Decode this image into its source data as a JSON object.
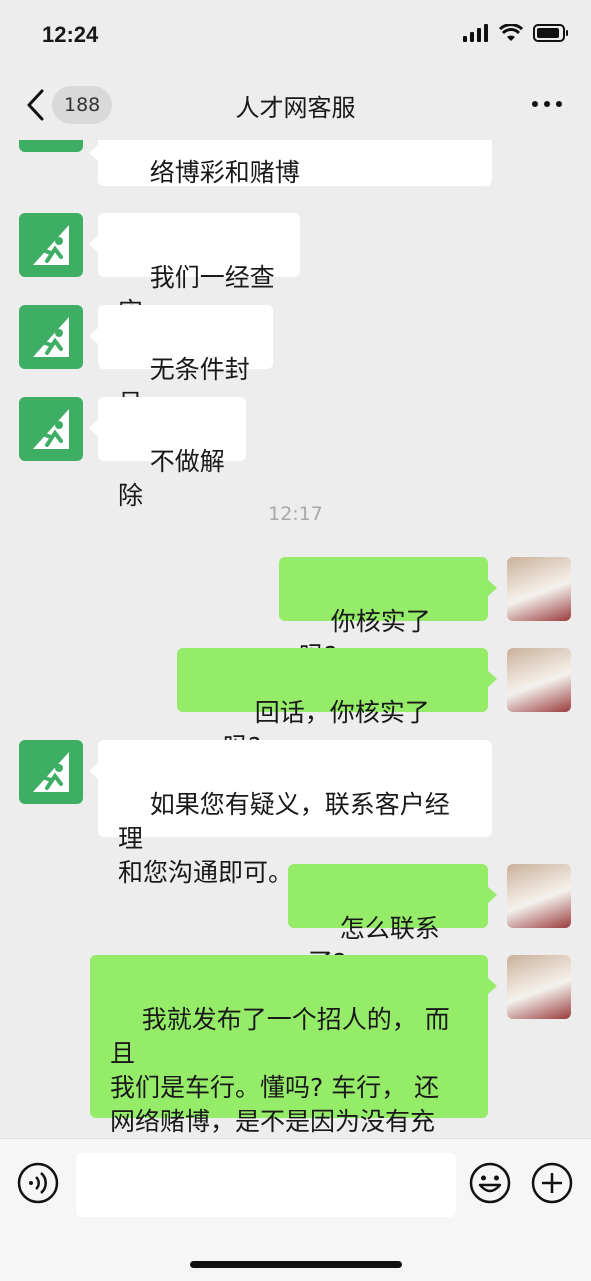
{
  "status_bar": {
    "time": "12:24"
  },
  "header": {
    "badge_count": "188",
    "title": "人才网客服"
  },
  "colors": {
    "outgoing_bubble": "#95ec69",
    "incoming_bubble": "#ffffff",
    "cs_avatar": "#3fae65",
    "background": "#ededed"
  },
  "messages": [
    {
      "side": "in",
      "text": "络博彩和赌博"
    },
    {
      "side": "in",
      "text": "我们一经查实"
    },
    {
      "side": "in",
      "text": "无条件封号"
    },
    {
      "side": "in",
      "text": "不做解除"
    },
    {
      "side": "out",
      "text": "你核实了吗?"
    },
    {
      "side": "out",
      "text": "回话，你核实了吗?"
    },
    {
      "side": "in",
      "text": "如果您有疑义，联系客户经理\n和您沟通即可。"
    },
    {
      "side": "out",
      "text": "怎么联系了?"
    },
    {
      "side": "out",
      "text": "我就发布了一个招人的， 而且\n我们是车行。懂吗? 车行， 还\n网络赌博，是不是因为没有充\n值啊?"
    }
  ],
  "timestamp": "12:17",
  "icons": {
    "back": "chevron-left-icon",
    "more": "ellipsis-icon",
    "voice": "voice-icon",
    "emoji": "emoji-icon",
    "plus": "plus-icon"
  }
}
